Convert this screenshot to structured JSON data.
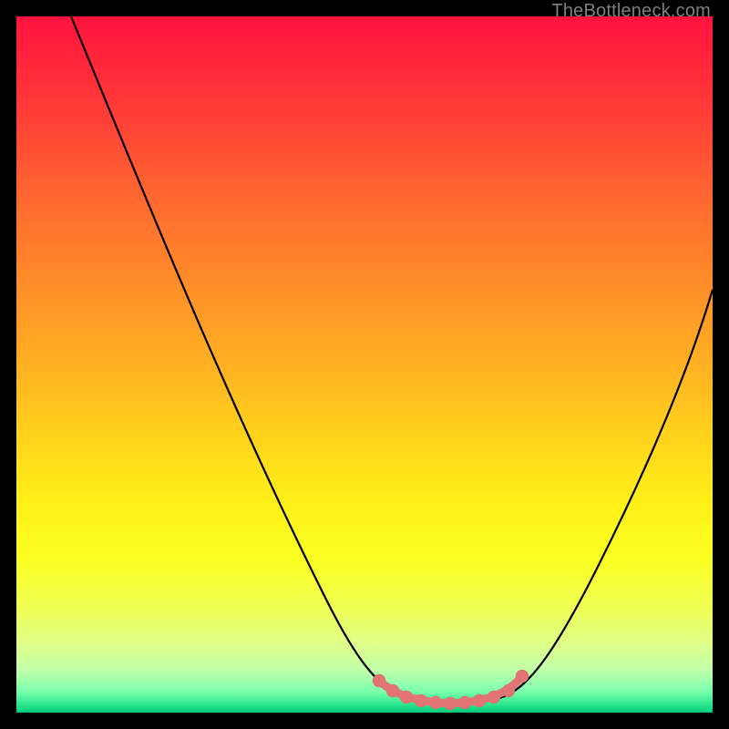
{
  "watermark": "TheBottleneck.com",
  "chart_data": {
    "type": "line",
    "title": "",
    "xlabel": "",
    "ylabel": "",
    "xlim": [
      0,
      100
    ],
    "ylim": [
      0,
      100
    ],
    "grid": false,
    "legend": false,
    "series": [
      {
        "name": "bottleneck-curve",
        "x": [
          8,
          15,
          22,
          30,
          38,
          45,
          50,
          53,
          56,
          60,
          64,
          68,
          72,
          78,
          84,
          90,
          96,
          100
        ],
        "y": [
          100,
          86,
          72,
          56,
          40,
          24,
          12,
          5,
          2,
          1,
          1,
          2,
          5,
          13,
          26,
          40,
          54,
          64
        ]
      },
      {
        "name": "optimal-range-markers",
        "x": [
          53,
          55,
          57,
          59,
          61,
          63,
          65,
          67,
          69,
          71
        ],
        "y": [
          4,
          2,
          1.5,
          1,
          1,
          1,
          1,
          1.5,
          2.5,
          4
        ]
      }
    ],
    "colors": {
      "curve": "#000000",
      "markers": "#e37474",
      "gradient_top": "#ff133f",
      "gradient_bottom": "#00c97a"
    },
    "annotations": []
  }
}
